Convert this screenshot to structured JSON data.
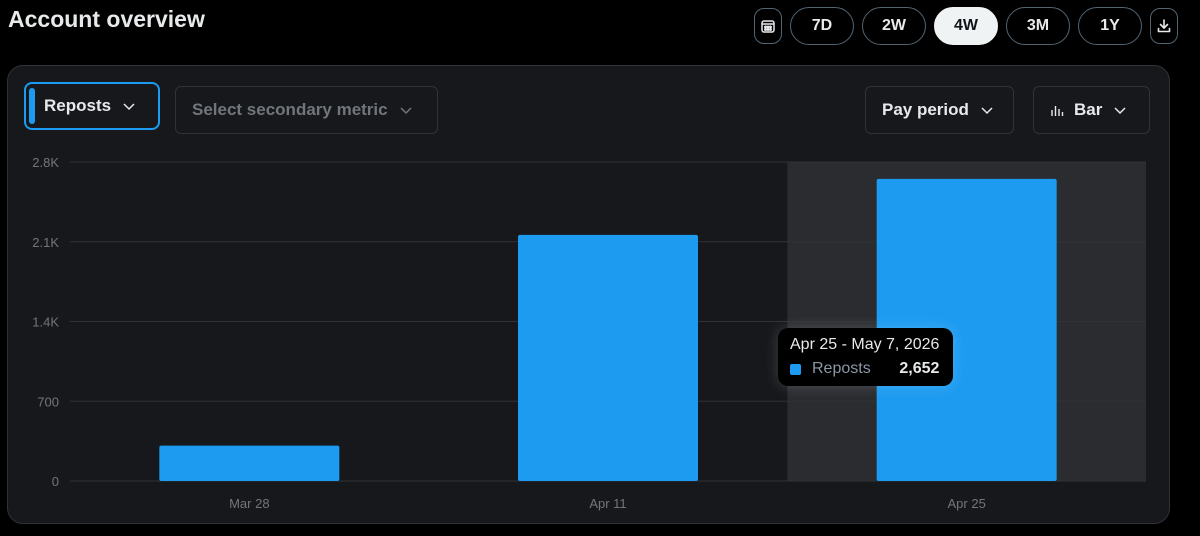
{
  "header": {
    "title": "Account overview",
    "ranges": [
      {
        "label": "7D",
        "active": false
      },
      {
        "label": "2W",
        "active": false
      },
      {
        "label": "4W",
        "active": true
      },
      {
        "label": "3M",
        "active": false
      },
      {
        "label": "1Y",
        "active": false
      }
    ]
  },
  "controls": {
    "primary_metric": "Reposts",
    "secondary_metric_placeholder": "Select secondary metric",
    "period": "Pay period",
    "chart_kind": "Bar"
  },
  "colors": {
    "accent": "#1d9bf0",
    "highlight": "#2a2c30"
  },
  "chart_data": {
    "type": "bar",
    "categories": [
      "Mar 28",
      "Apr 11",
      "Apr 25"
    ],
    "series": [
      {
        "name": "Reposts",
        "values": [
          310,
          2160,
          2652
        ]
      }
    ],
    "ylim": [
      0,
      2800
    ],
    "yticks": [
      0,
      700,
      1400,
      2100,
      2800
    ],
    "ytick_labels": [
      "0",
      "700",
      "1.4K",
      "2.1K",
      "2.8K"
    ],
    "grid": true,
    "highlighted_index": 2
  },
  "tooltip": {
    "date_range": "Apr 25 - May 7, 2026",
    "series_name": "Reposts",
    "value": "2,652"
  }
}
